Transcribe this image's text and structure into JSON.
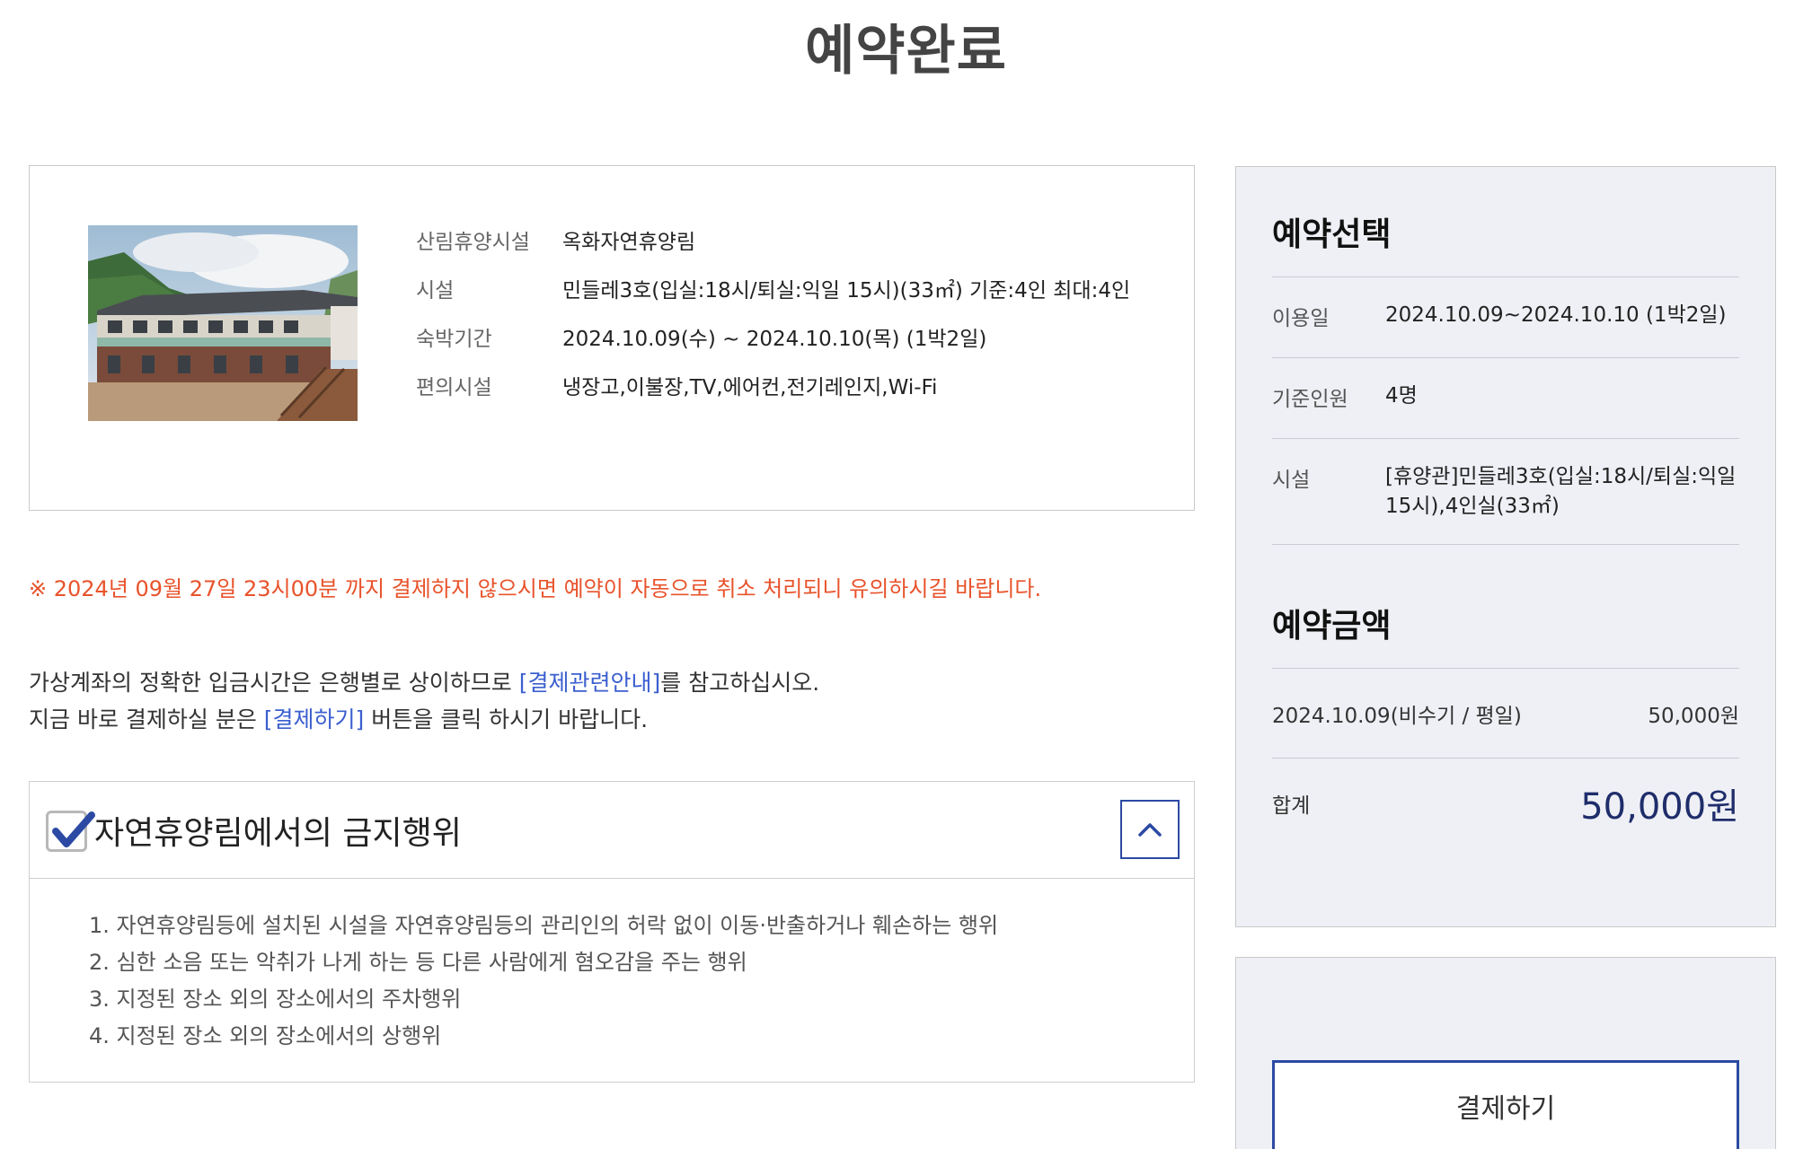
{
  "page_title": "예약완료",
  "facility": {
    "rows": [
      {
        "label": "산림휴양시설",
        "value": "옥화자연휴양림"
      },
      {
        "label": "시설",
        "value": "민들레3호(입실:18시/퇴실:익일 15시)(33㎡) 기준:4인 최대:4인"
      },
      {
        "label": "숙박기간",
        "value": "2024.10.09(수) ~ 2024.10.10(목) (1박2일)"
      },
      {
        "label": "편의시설",
        "value": "냉장고,이불장,TV,에어컨,전기레인지,Wi-Fi"
      }
    ]
  },
  "deadline_notice": "※ 2024년 09월 27일 23시00분 까지 결제하지 않으시면 예약이 자동으로 취소 처리되니 유의하시길 바랍니다.",
  "guide": {
    "line1_pre": "가상계좌의 정확한 입금시간은 은행별로 상이하므로 ",
    "line1_link": "[결제관련안내]",
    "line1_post": "를 참고하십시오.",
    "line2_pre": "지금 바로 결제하실 분은 ",
    "line2_link": "[결제하기]",
    "line2_post": " 버튼을 클릭 하시기 바랍니다."
  },
  "prohibit": {
    "title": "자연휴양림에서의 금지행위",
    "items": [
      "1. 자연휴양림등에 설치된 시설을 자연휴양림등의 관리인의 허락 없이 이동·반출하거나 훼손하는 행위",
      "2. 심한 소음 또는 악취가 나게 하는 등 다른 사람에게 혐오감을 주는 행위",
      "3. 지정된 장소 외의 장소에서의 주차행위",
      "4. 지정된 장소 외의 장소에서의 상행위"
    ]
  },
  "summary": {
    "title": "예약선택",
    "rows": [
      {
        "label": "이용일",
        "value": "2024.10.09~2024.10.10 (1박2일)"
      },
      {
        "label": "기준인원",
        "value": "4명"
      },
      {
        "label": "시설",
        "value": "[휴양관]민들레3호(입실:18시/퇴실:익일 15시),4인실(33㎡)"
      }
    ],
    "price_title": "예약금액",
    "price_detail_label": "2024.10.09(비수기 / 평일)",
    "price_detail_value": "50,000원",
    "total_label": "합계",
    "total_value": "50,000원"
  },
  "pay_button": "결제하기",
  "colors": {
    "accent": "#2c4aa3",
    "warning": "#e8532b",
    "link": "#3b5fcf",
    "panel_bg": "#eef0f5"
  }
}
